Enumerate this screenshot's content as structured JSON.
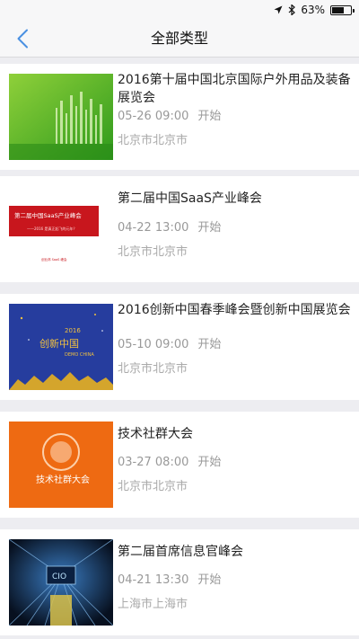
{
  "status_bar": {
    "battery": "63%",
    "battery_level": 0.63,
    "icons": [
      "location-arrow-icon",
      "bluetooth-icon",
      "battery-icon"
    ]
  },
  "nav": {
    "title": "全部类型",
    "back_icon": "chevron-left-icon"
  },
  "colors": {
    "accent": "#4a90e2",
    "background": "#ededf1",
    "text_primary": "#222222",
    "text_secondary": "#999999"
  },
  "events": [
    {
      "title": "2016第十届中国北京国际户外用品及装备展览会",
      "date_time": "05-26 09:00",
      "status": "开始",
      "location": "北京市北京市"
    },
    {
      "title": "第二届中国SaaS产业峰会",
      "date_time": "04-22 13:00",
      "status": "开始",
      "location": "北京市北京市",
      "thumb_text": [
        "第二届中国SaaS产业峰会",
        "——2016 是真正起飞的元年？",
        "创业邦 SaaS 峰会"
      ]
    },
    {
      "title": "2016创新中国春季峰会暨创新中国展览会",
      "date_time": "05-10 09:00",
      "status": "开始",
      "location": "北京市北京市",
      "thumb_text": [
        "创新中国",
        "2016",
        "DEMO CHINA"
      ]
    },
    {
      "title": "技术社群大会",
      "date_time": "03-27 08:00",
      "status": "开始",
      "location": "北京市北京市",
      "thumb_text": [
        "技术社群大会"
      ]
    },
    {
      "title": "第二届首席信息官峰会",
      "date_time": "04-21 13:30",
      "status": "开始",
      "location": "上海市上海市",
      "thumb_text": [
        "CIO"
      ]
    }
  ]
}
